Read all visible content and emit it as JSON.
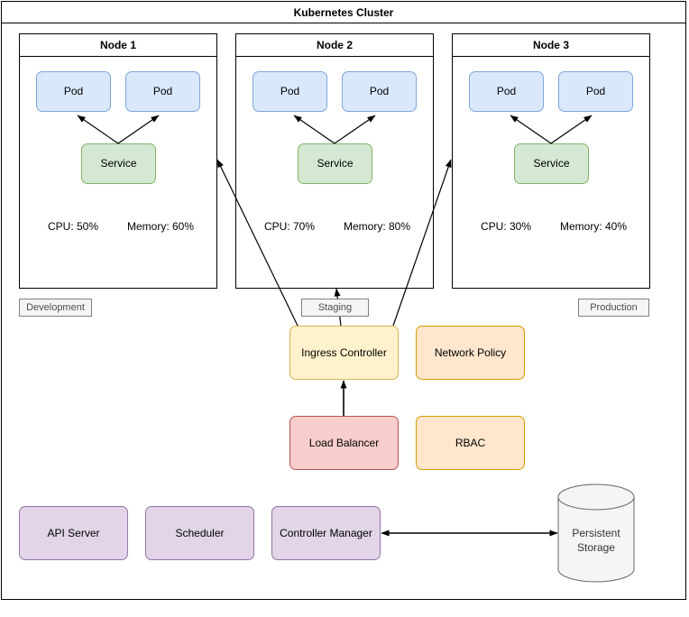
{
  "cluster": {
    "title": "Kubernetes Cluster"
  },
  "nodes": [
    {
      "title": "Node 1",
      "pods": [
        "Pod",
        "Pod"
      ],
      "service": "Service",
      "cpu": "CPU: 50%",
      "memory": "Memory: 60%",
      "environment": "Development"
    },
    {
      "title": "Node 2",
      "pods": [
        "Pod",
        "Pod"
      ],
      "service": "Service",
      "cpu": "CPU: 70%",
      "memory": "Memory: 80%",
      "environment": "Staging"
    },
    {
      "title": "Node 3",
      "pods": [
        "Pod",
        "Pod"
      ],
      "service": "Service",
      "cpu": "CPU: 30%",
      "memory": "Memory: 40%",
      "environment": "Production"
    }
  ],
  "networking": {
    "ingress_controller": "Ingress Controller",
    "network_policy": "Network Policy",
    "load_balancer": "Load Balancer",
    "rbac": "RBAC"
  },
  "control_plane": {
    "api_server": "API Server",
    "scheduler": "Scheduler",
    "controller_manager": "Controller Manager",
    "persistent_storage_line1": "Persistent",
    "persistent_storage_line2": "Storage"
  },
  "colors": {
    "pod_fill": "#dae8fc",
    "pod_stroke": "#7ea6d9",
    "service_fill": "#d5e8d4",
    "service_stroke": "#82b366",
    "ingress_fill": "#fff2cc",
    "ingress_stroke": "#d6b656",
    "load_balancer_fill": "#f8cecc",
    "load_balancer_stroke": "#b85450",
    "policy_fill": "#ffe6cc",
    "policy_stroke": "#d79b00",
    "control_plane_fill": "#e1d5e7",
    "control_plane_stroke": "#9673a6",
    "storage_fill": "#f5f5f5",
    "storage_stroke": "#666666",
    "frame_stroke": "#000000",
    "tag_fill": "#f5f5f5",
    "tag_stroke": "#808080"
  }
}
